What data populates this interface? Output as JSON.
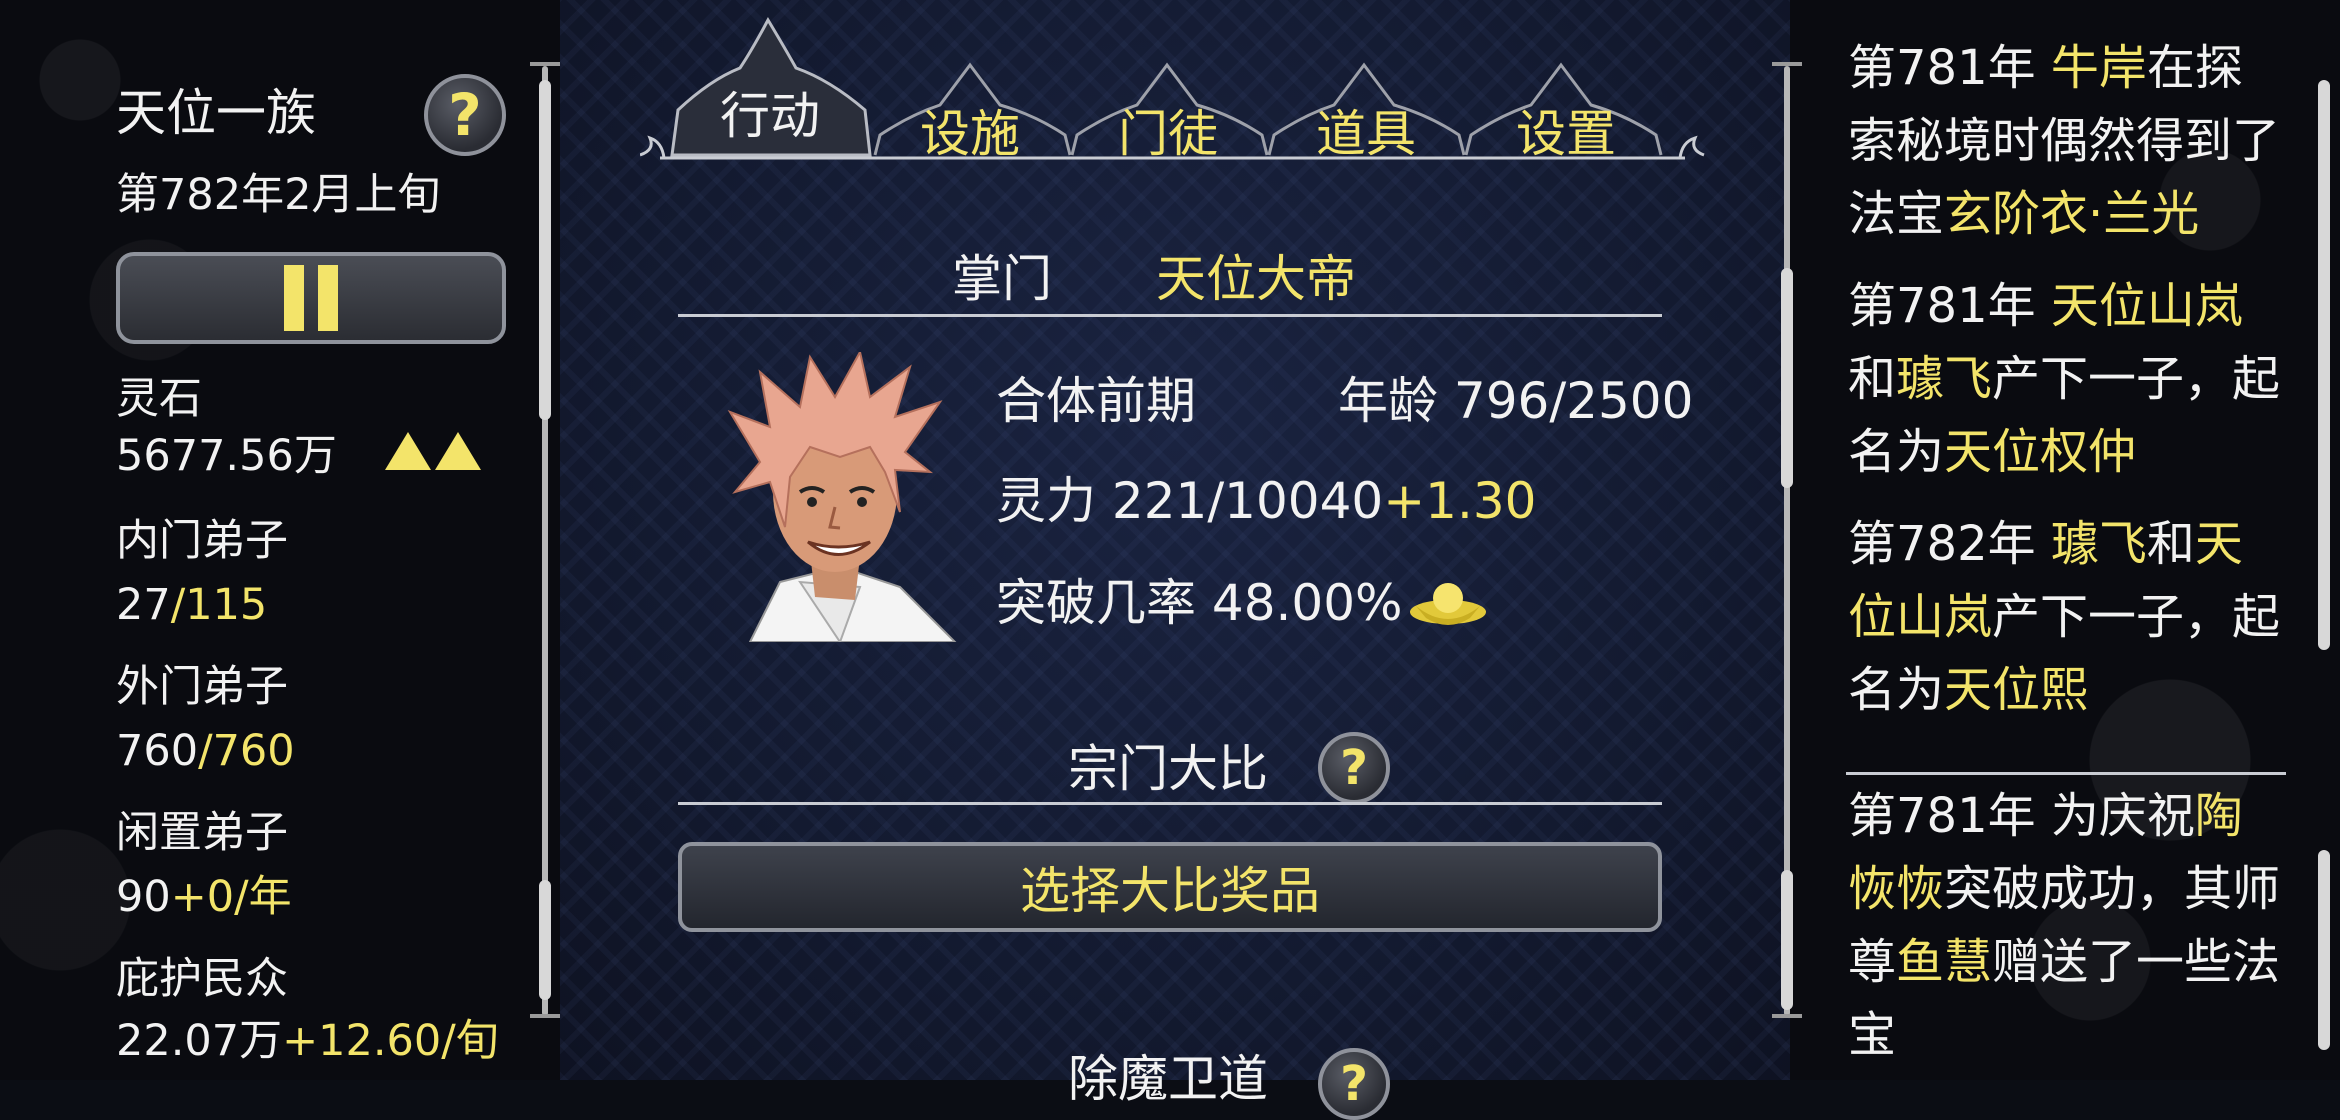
{
  "left": {
    "sect_name": "天位一族",
    "date": "第782年2月上旬",
    "stats": [
      {
        "label": "灵石",
        "value": "5677.56万",
        "extra": ""
      },
      {
        "label": "内门弟子",
        "value": "27",
        "extra": "/115"
      },
      {
        "label": "外门弟子",
        "value": "760",
        "extra": "/760"
      },
      {
        "label": "闲置弟子",
        "value": "90",
        "extra": "+0/年"
      },
      {
        "label": "庇护民众",
        "value": "22.07万",
        "extra": "+12.60/旬"
      }
    ]
  },
  "tabs": [
    {
      "label": "行动"
    },
    {
      "label": "设施"
    },
    {
      "label": "门徒"
    },
    {
      "label": "道具"
    },
    {
      "label": "设置"
    }
  ],
  "leader": {
    "title": "掌门",
    "name": "天位大帝",
    "realm": "合体前期",
    "age_label": "年龄",
    "age": "796/2500",
    "spirit_label": "灵力",
    "spirit": "221/10040",
    "spirit_rate": "+1.30",
    "breakthrough_label": "突破几率",
    "breakthrough": "48.00%"
  },
  "tournament": {
    "title": "宗门大比",
    "button": "选择大比奖品"
  },
  "next_section": {
    "title": "除魔卫道"
  },
  "log": [
    {
      "parts": [
        {
          "t": "第781年 ",
          "c": "w"
        },
        {
          "t": "牛岸",
          "c": "y"
        },
        {
          "t": "在探索秘境时偶然得到了法宝",
          "c": "w"
        },
        {
          "t": "玄阶衣·兰光",
          "c": "y"
        }
      ]
    },
    {
      "parts": [
        {
          "t": "第781年 ",
          "c": "w"
        },
        {
          "t": "天位山岚",
          "c": "y"
        },
        {
          "t": "和",
          "c": "w"
        },
        {
          "t": "璩飞",
          "c": "y"
        },
        {
          "t": "产下一子，起名为",
          "c": "w"
        },
        {
          "t": "天位权仲",
          "c": "y"
        }
      ]
    },
    {
      "parts": [
        {
          "t": "第782年 ",
          "c": "w"
        },
        {
          "t": "璩飞",
          "c": "y"
        },
        {
          "t": "和",
          "c": "w"
        },
        {
          "t": "天位山岚",
          "c": "y"
        },
        {
          "t": "产下一子，起名为",
          "c": "w"
        },
        {
          "t": "天位熙",
          "c": "y"
        }
      ]
    },
    {
      "parts": [
        {
          "t": "第781年 为庆祝",
          "c": "w"
        },
        {
          "t": "陶恢恢",
          "c": "y"
        },
        {
          "t": "突破成功，其师尊",
          "c": "w"
        },
        {
          "t": "鱼慧",
          "c": "y"
        },
        {
          "t": "赠送了一些法宝",
          "c": "w"
        }
      ]
    }
  ],
  "colors": {
    "accent_yellow": "#f3e46a",
    "text_white": "#f2f2f2"
  }
}
